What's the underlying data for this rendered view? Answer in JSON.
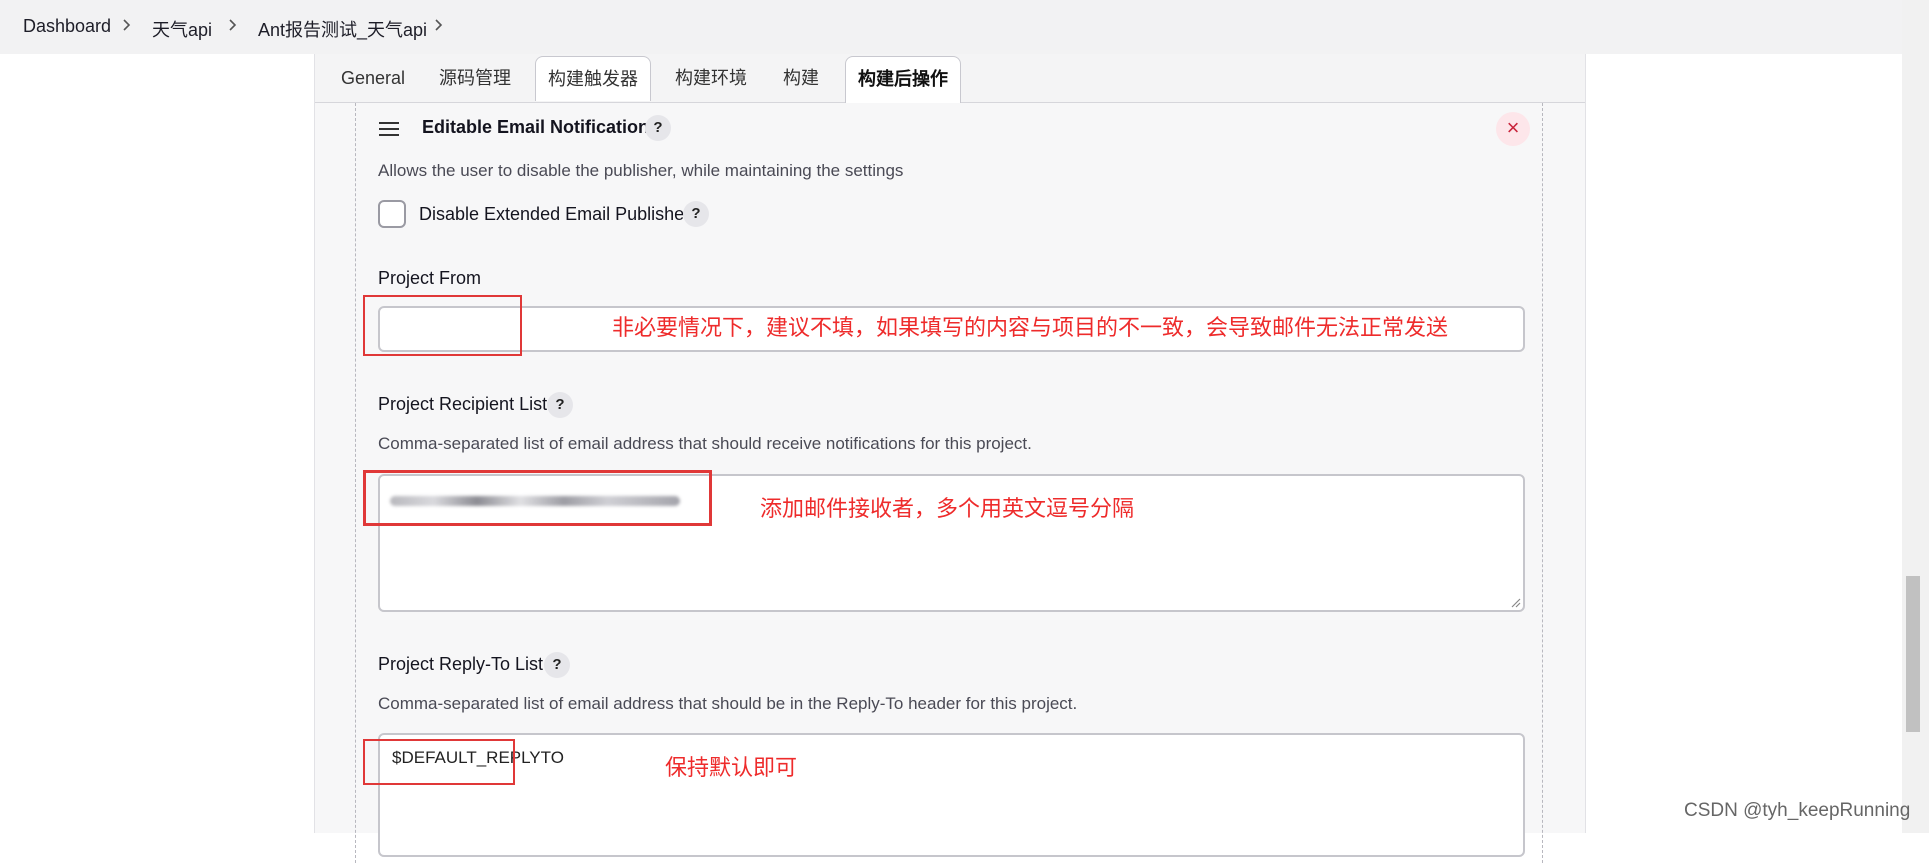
{
  "breadcrumb": [
    "Dashboard",
    "天气api",
    "Ant报告测试_天气api"
  ],
  "tabs": [
    "General",
    "源码管理",
    "构建触发器",
    "构建环境",
    "构建",
    "构建后操作"
  ],
  "active_tab": "构建后操作",
  "step": {
    "title": "Editable Email Notification",
    "help": "?",
    "close": "×",
    "description": "Allows the user to disable the publisher, while maintaining the settings",
    "disable_checkbox_label": "Disable Extended Email Publisher",
    "disable_checkbox_checked": false
  },
  "project_from": {
    "label": "Project From",
    "value": ""
  },
  "recipient_list": {
    "label": "Project Recipient List",
    "description": "Comma-separated list of email address that should receive notifications for this project.",
    "value": "[blurred email addresses]"
  },
  "reply_to": {
    "label": "Project Reply-To List",
    "description": "Comma-separated list of email address that should be in the Reply-To header for this project.",
    "value": "$DEFAULT_REPLYTO"
  },
  "annotations": {
    "project_from_note": "非必要情况下，建议不填，如果填写的内容与项目的不一致，会导致邮件无法正常发送",
    "recipient_note": "添加邮件接收者，多个用英文逗号分隔",
    "reply_to_note": "保持默认即可",
    "color": "#ee2b2b"
  },
  "watermark": "CSDN @tyh_keepRunning"
}
